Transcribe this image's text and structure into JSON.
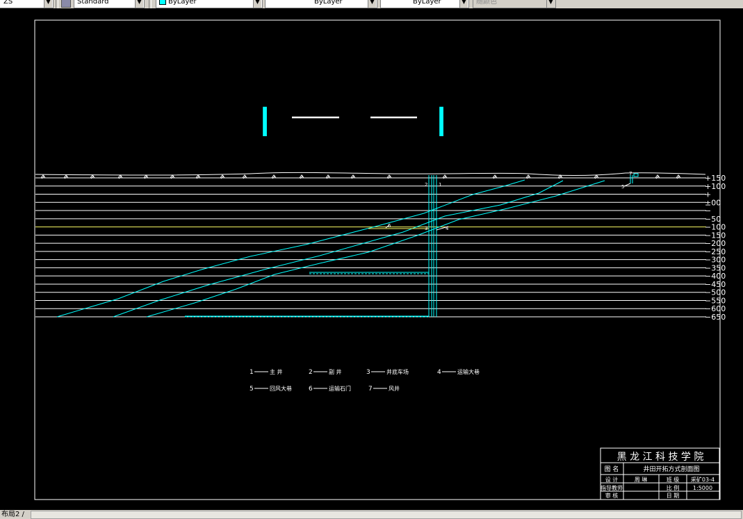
{
  "toolbar": {
    "combos": [
      {
        "value": "ZS",
        "disabled": false
      },
      {
        "value": "Standard",
        "disabled": false
      },
      {
        "value": "ByLayer",
        "swatch": "#00ffff",
        "disabled": false
      },
      {
        "value": "ByLayer",
        "disabled": false
      },
      {
        "value": "ByLayer",
        "disabled": false
      },
      {
        "value": "随颜色",
        "disabled": true
      }
    ]
  },
  "section_title": {
    "left": "I",
    "right": "I"
  },
  "elevations": [
    "+150",
    "+100",
    "+",
    "±00",
    "−",
    "−50",
    "−100",
    "−150",
    "−200",
    "−250",
    "−300",
    "−350",
    "−400",
    "−450",
    "−500",
    "−550",
    "−600",
    "−650"
  ],
  "legend": [
    {
      "num": "1",
      "label": "主 井"
    },
    {
      "num": "2",
      "label": "副 井"
    },
    {
      "num": "3",
      "label": "井底车场"
    },
    {
      "num": "4",
      "label": "运输大巷"
    },
    {
      "num": "5",
      "label": "回风大巷"
    },
    {
      "num": "6",
      "label": "运输石门"
    },
    {
      "num": "7",
      "label": "风井"
    }
  ],
  "marks": {
    "shaft_2": "2",
    "shaft_1": "1",
    "station_3": "3",
    "haulage_4": "4",
    "crosscut_6": "6",
    "vent_7": "7",
    "return_5": "5"
  },
  "title_block": {
    "school": "黑 龙 江 科 技 学 院",
    "name_label": "图 名",
    "name_value": "井田开拓方式剖面图",
    "design_label": "设 计",
    "design_value": "周 琳",
    "class_label": "班 级",
    "class_value": "采矿03-4",
    "advisor_label": "指导教师",
    "scale_label": "比 例",
    "scale_value": "1:5000",
    "review_label": "审 核",
    "date_label": "日 期"
  },
  "bottom": {
    "layout_tab": "布局2 /"
  },
  "colors": {
    "background": "#000000",
    "line": "#ffffff",
    "seam": "#00ffff",
    "datum": "#ffff66",
    "toolbar": "#d4d0c8"
  }
}
